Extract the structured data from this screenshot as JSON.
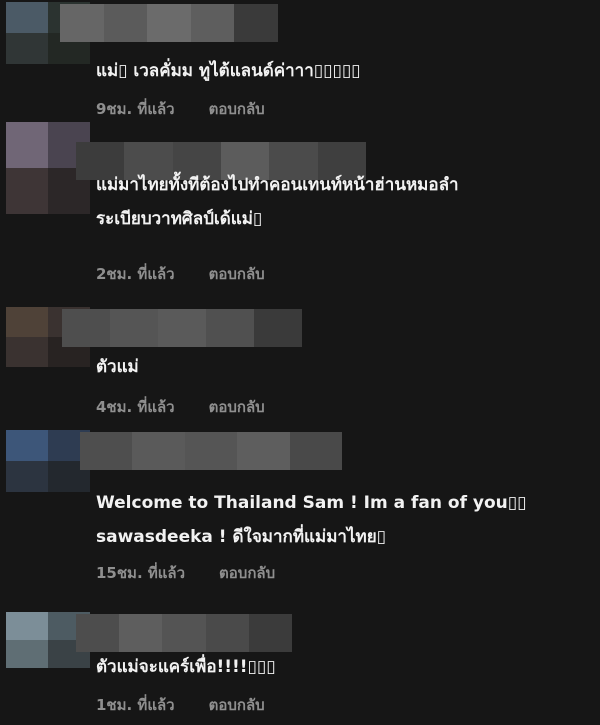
{
  "comments": [
    {
      "text_lines": [
        "แม่▯ เวลคั่มม ทูไต้แลนด์ค่าาา▯▯▯▯▯"
      ],
      "time": "9ชม. ที่แล้ว",
      "reply": "ตอบกลับ",
      "avatar_colors": [
        "#4b5a66",
        "#2b3330",
        "#303636",
        "#232824"
      ],
      "name_blur_colors": [
        "#666666",
        "#5b5b5b",
        "#6b6b6b",
        "#5e5e5e",
        "#3a3a3a"
      ]
    },
    {
      "text_lines": [
        "แม่มาไทยทั้งทีต้องไปทำคอนเทนท์หน้าฮ่านหมอลำ",
        "ระเบียบวาทศิลป์เด้แม่▯"
      ],
      "time": "2ชม. ที่แล้ว",
      "reply": "ตอบกลับ",
      "avatar_colors": [
        "#706676",
        "#4a4450",
        "#3e3536",
        "#2c2728"
      ],
      "name_blur_colors": [
        "#3c3c3c",
        "#4c4c4c",
        "#454545",
        "#5c5c5c",
        "#4b4b4b",
        "#3f3f3f"
      ]
    },
    {
      "text_lines": [
        "ตัวแม่"
      ],
      "time": "4ชม. ที่แล้ว",
      "reply": "ตอบกลับ",
      "avatar_colors": [
        "#4f4238",
        "#3a3230",
        "#3a3230",
        "#282322"
      ],
      "name_blur_colors": [
        "#4e4e4e",
        "#555555",
        "#5a5a5a",
        "#505050",
        "#3a3a3a"
      ]
    },
    {
      "text_lines": [
        "Welcome to Thailand Sam ! Im a fan of you▯▯",
        "sawasdeeka ! ดีใจมากที่แม่มาไทย▯"
      ],
      "time": "15ชม. ที่แล้ว",
      "reply": "ตอบกลับ",
      "avatar_colors": [
        "#3d5679",
        "#2e3c52",
        "#2c3440",
        "#23282e"
      ],
      "name_blur_colors": [
        "#4e4e4e",
        "#5a5a5a",
        "#555555",
        "#5e5e5e",
        "#494949"
      ]
    },
    {
      "text_lines": [
        "ตัวแม่จะแคร์เพื่อ!!!!▯▯▯"
      ],
      "time": "1ชม. ที่แล้ว",
      "reply": "ตอบกลับ",
      "avatar_colors": [
        "#7c8e98",
        "#4d5b62",
        "#5f6e74",
        "#3a4246"
      ],
      "name_blur_colors": [
        "#4d4d4d",
        "#5e5e5e",
        "#545454",
        "#4a4a4a",
        "#3b3b3b"
      ]
    }
  ]
}
